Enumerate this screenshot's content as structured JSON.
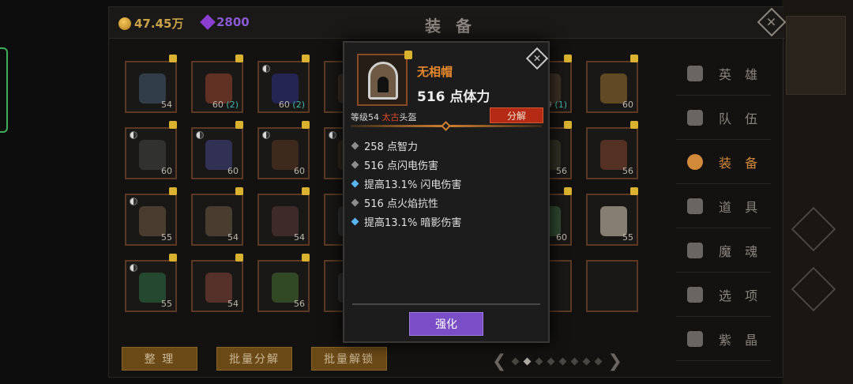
{
  "currency": {
    "gold": "47.45万",
    "gems": "2800"
  },
  "header": {
    "title": "装 备",
    "close": "✕"
  },
  "colors": {
    "accent": "#d28a3a",
    "name": "#e6892e",
    "rarity": "#e04a2a",
    "enhance": "#7a4ec4",
    "salvage": "#b42a14"
  },
  "grid": [
    {
      "lvl": "54",
      "bonus": "",
      "art": "boots-icon",
      "color": "#3a4a5a",
      "yy": false
    },
    {
      "lvl": "60",
      "bonus": "(2)",
      "art": "dagger-icon",
      "color": "#7a3a2a",
      "yy": false
    },
    {
      "lvl": "60",
      "bonus": "(2)",
      "art": "armor-icon",
      "color": "#2a2a6a",
      "yy": true
    },
    {
      "lvl": "",
      "bonus": "",
      "art": "item-icon",
      "color": "#4a3a2a",
      "yy": false
    },
    {
      "lvl": "59",
      "bonus": "(1)",
      "art": "item-icon",
      "color": "#4a3a2a",
      "yy": false
    },
    {
      "lvl": "60",
      "bonus": "",
      "art": "helmet-icon",
      "color": "#7a5a2a",
      "yy": false
    },
    {
      "lvl": "60",
      "bonus": "",
      "art": "hood-icon",
      "color": "#3a3a3a",
      "yy": true
    },
    {
      "lvl": "60",
      "bonus": "",
      "art": "shirt-icon",
      "color": "#3a3a6a",
      "yy": true
    },
    {
      "lvl": "60",
      "bonus": "",
      "art": "boots-icon",
      "color": "#4a3020",
      "yy": true
    },
    {
      "lvl": "",
      "bonus": "",
      "art": "item-icon",
      "color": "#3a3020",
      "yy": true
    },
    {
      "lvl": "56",
      "bonus": "",
      "art": "item-icon",
      "color": "#3a3a2a",
      "yy": false
    },
    {
      "lvl": "56",
      "bonus": "",
      "art": "armor-icon",
      "color": "#6a3a2a",
      "yy": false
    },
    {
      "lvl": "55",
      "bonus": "",
      "art": "scarf-icon",
      "color": "#5a4a3a",
      "yy": true
    },
    {
      "lvl": "54",
      "bonus": "",
      "art": "shield-icon",
      "color": "#5a4a3a",
      "yy": false
    },
    {
      "lvl": "54",
      "bonus": "",
      "art": "book-icon",
      "color": "#4a3030",
      "yy": false
    },
    {
      "lvl": "",
      "bonus": "",
      "art": "item-icon",
      "color": "#3a3a3a",
      "yy": false
    },
    {
      "lvl": "60",
      "bonus": "",
      "art": "item-icon",
      "color": "#3a5a3a",
      "yy": false
    },
    {
      "lvl": "55",
      "bonus": "",
      "art": "boots-icon",
      "color": "#aaa090",
      "yy": false
    },
    {
      "lvl": "55",
      "bonus": "",
      "art": "boots-icon",
      "color": "#2a5a3a",
      "yy": true
    },
    {
      "lvl": "54",
      "bonus": "",
      "art": "amulet-icon",
      "color": "#6a3a30",
      "yy": false
    },
    {
      "lvl": "56",
      "bonus": "",
      "art": "belt-icon",
      "color": "#3a5a2a",
      "yy": false
    },
    {
      "lvl": "",
      "bonus": "",
      "art": "item-icon",
      "color": "#3a3a3a",
      "yy": false
    },
    {
      "lvl": "",
      "bonus": "",
      "art": "empty",
      "color": "#1a1816",
      "yy": false
    },
    {
      "lvl": "",
      "bonus": "",
      "art": "empty",
      "color": "#1a1816",
      "yy": false
    }
  ],
  "buttons": {
    "sort": "整 理",
    "bulk_salvage": "批量分解",
    "bulk_unlock": "批量解锁"
  },
  "pager": {
    "prev": "❮",
    "next": "❯",
    "pages": 8,
    "current": 2
  },
  "sidebar": [
    {
      "label": "英 雄",
      "icon": "hero-icon",
      "active": false
    },
    {
      "label": "队 伍",
      "icon": "flag-icon",
      "active": false
    },
    {
      "label": "装 备",
      "icon": "helmet-icon",
      "active": true
    },
    {
      "label": "道 具",
      "icon": "bag-icon",
      "active": false
    },
    {
      "label": "魔 魂",
      "icon": "flame-icon",
      "active": false
    },
    {
      "label": "选 项",
      "icon": "gear-icon",
      "active": false
    },
    {
      "label": "紫 晶",
      "icon": "crystal-icon",
      "active": false
    }
  ],
  "tooltip": {
    "name": "无相帽",
    "main_stat": "516 点体力",
    "level_prefix": "等级54 ",
    "rarity": "太古",
    "slot": "头盔",
    "salvage": "分解",
    "close": "✕",
    "attrs": [
      {
        "text": "258 点智力",
        "blue": false
      },
      {
        "text": "516 点闪电伤害",
        "blue": false
      },
      {
        "text": "提高13.1% 闪电伤害",
        "blue": true
      },
      {
        "text": "516 点火焰抗性",
        "blue": false
      },
      {
        "text": "提高13.1% 暗影伤害",
        "blue": true
      }
    ],
    "enhance": "强化"
  }
}
